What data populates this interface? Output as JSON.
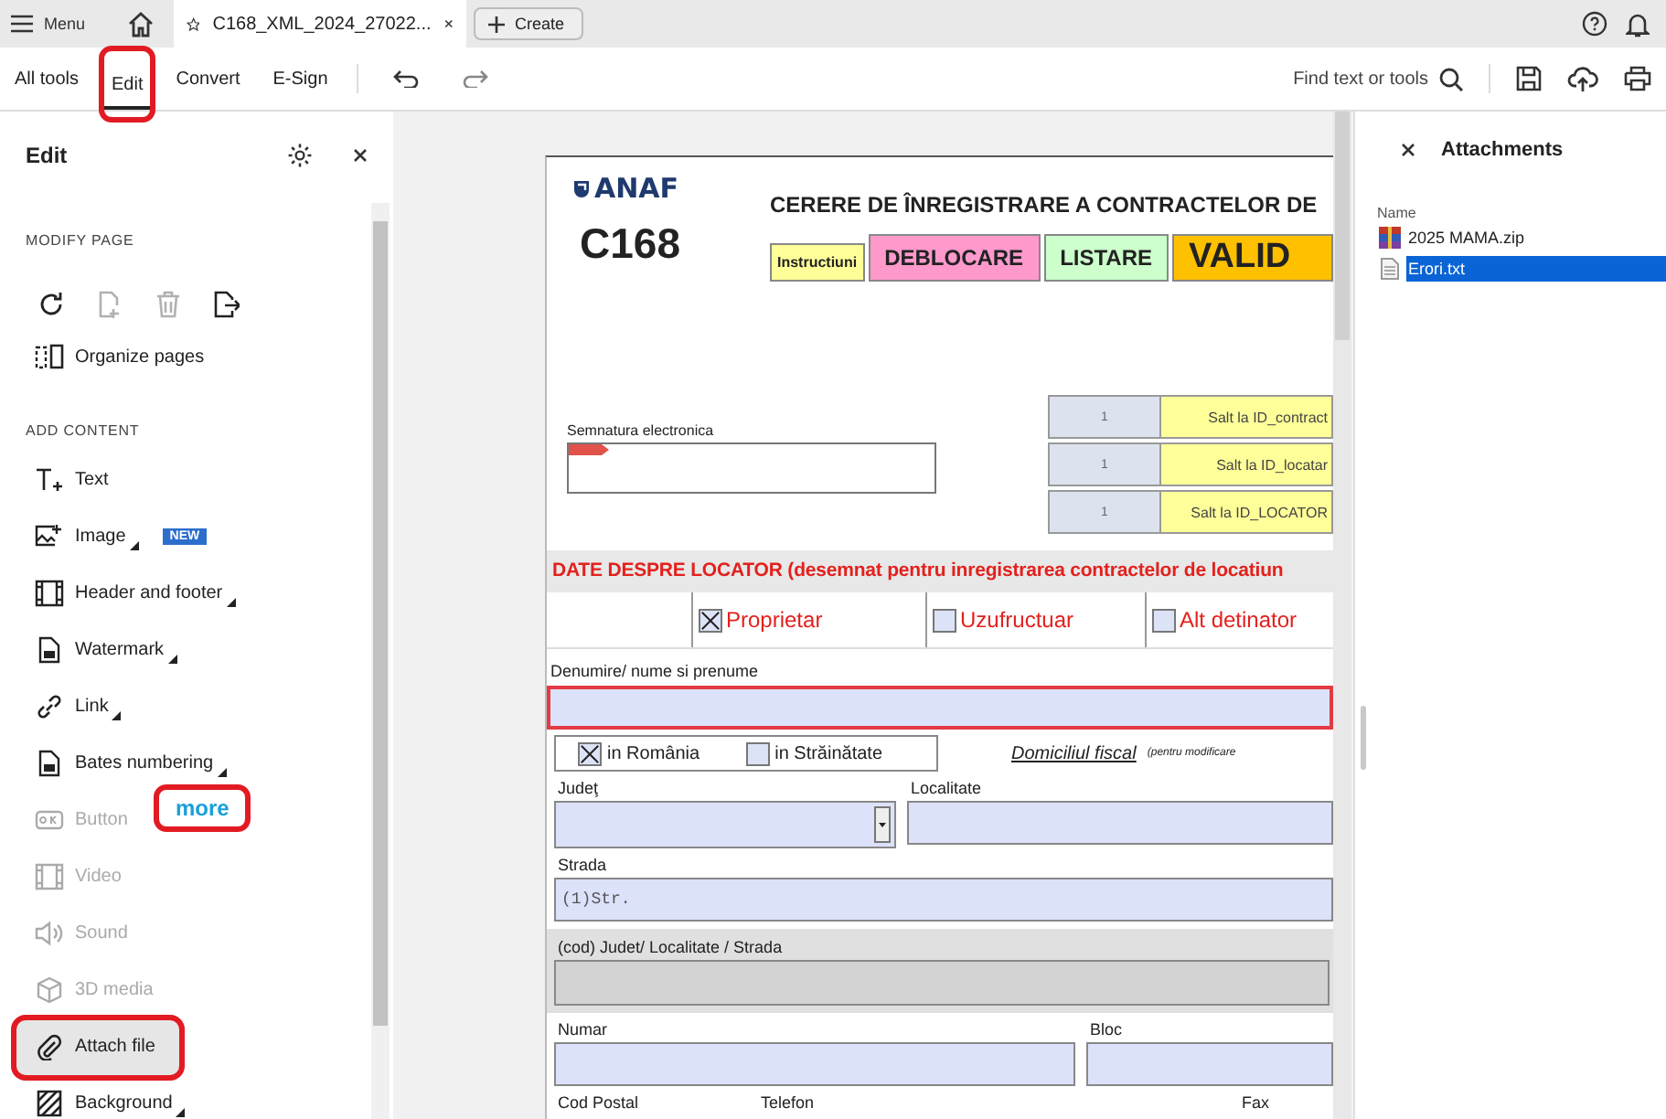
{
  "top_bar": {
    "menu": "Menu",
    "tab_title": "C168_XML_2024_27022...",
    "create": "Create"
  },
  "toolbar": {
    "tabs": [
      {
        "label": "All tools",
        "selected": false,
        "circled": false
      },
      {
        "label": "Edit",
        "selected": true,
        "circled": true
      },
      {
        "label": "Convert",
        "selected": false,
        "circled": false
      },
      {
        "label": "E-Sign",
        "selected": false,
        "circled": false
      }
    ],
    "search": "Find text or tools"
  },
  "edit_panel": {
    "title": "Edit",
    "modify_heading": "MODIFY PAGE",
    "page_tools": [
      {
        "kind": "rotate",
        "disabled": false
      },
      {
        "kind": "insert",
        "disabled": true
      },
      {
        "kind": "delete",
        "disabled": true
      },
      {
        "kind": "extract",
        "disabled": false
      }
    ],
    "organize": "Organize pages",
    "add_heading": "ADD CONTENT",
    "items": [
      {
        "kind": "text",
        "label": "Text",
        "disabled": false,
        "has_menu": false,
        "selected": false,
        "circled": false
      },
      {
        "kind": "image",
        "label": "Image",
        "badge": "NEW",
        "disabled": false,
        "has_menu": true,
        "selected": false,
        "circled": false
      },
      {
        "kind": "header",
        "label": "Header and footer",
        "disabled": false,
        "has_menu": true,
        "selected": false,
        "circled": false
      },
      {
        "kind": "watermark",
        "label": "Watermark",
        "disabled": false,
        "has_menu": true,
        "selected": false,
        "circled": false
      },
      {
        "kind": "link",
        "label": "Link",
        "disabled": false,
        "has_menu": true,
        "selected": false,
        "circled": false
      },
      {
        "kind": "bates",
        "label": "Bates numbering",
        "disabled": false,
        "has_menu": true,
        "selected": false,
        "circled": false
      },
      {
        "kind": "button",
        "label": "Button",
        "disabled": true,
        "has_menu": false,
        "selected": false,
        "circled": false
      },
      {
        "kind": "video",
        "label": "Video",
        "disabled": true,
        "has_menu": false,
        "selected": false,
        "circled": false
      },
      {
        "kind": "sound",
        "label": "Sound",
        "disabled": true,
        "has_menu": false,
        "selected": false,
        "circled": false
      },
      {
        "kind": "media3d",
        "label": "3D media",
        "disabled": true,
        "has_menu": false,
        "selected": false,
        "circled": false
      },
      {
        "kind": "attach",
        "label": "Attach file",
        "disabled": false,
        "has_menu": false,
        "selected": true,
        "circled": true
      },
      {
        "kind": "background",
        "label": "Background",
        "disabled": false,
        "has_menu": true,
        "selected": false,
        "circled": false
      }
    ],
    "note": {
      "text": "more",
      "circled": true
    }
  },
  "document": {
    "logo": "ANAF",
    "code": "C168",
    "title": "CERERE DE ÎNREGISTRARE A CONTRACTELOR DE",
    "buttons": [
      {
        "label": "Instructiuni",
        "color": "#ffff99"
      },
      {
        "label": "DEBLOCARE",
        "color": "#ff99cc"
      },
      {
        "label": "LISTARE",
        "color": "#ccffcc"
      },
      {
        "label": "VALID",
        "color": "#ffc000"
      }
    ],
    "signature_label": "Semnatura electronica",
    "jumps": [
      {
        "value": "1",
        "label": "Salt la ID_contract"
      },
      {
        "value": "1",
        "label": "Salt la ID_locatar"
      },
      {
        "value": "1",
        "label": "Salt la ID_LOCATOR"
      }
    ],
    "section_title": "DATE DESPRE LOCATOR (desemnat pentru inregistrarea contractelor de locatiun",
    "roles": [
      {
        "label": "Proprietar",
        "checked": true
      },
      {
        "label": "Uzufructuar",
        "checked": false
      },
      {
        "label": "Alt detinator",
        "checked": false
      }
    ],
    "name_field": {
      "label": "Denumire/ nume si prenume",
      "required": true
    },
    "residence": [
      {
        "label": "in România",
        "checked": true
      },
      {
        "label": "in Străinătate",
        "checked": false
      }
    ],
    "fiscal_label": "Domiciliul fiscal",
    "fiscal_note": "(pentru modificare",
    "field_rows": [
      [
        {
          "kind": "select",
          "label": "Judeţ"
        },
        {
          "kind": "text",
          "label": "Localitate"
        }
      ],
      [
        {
          "kind": "text",
          "label": "Strada",
          "value": "(1)Str."
        }
      ],
      [
        {
          "kind": "readonly",
          "label": "(cod) Judet/ Localitate / Strada"
        }
      ],
      [
        {
          "kind": "text",
          "label": "Numar"
        },
        {
          "kind": "text",
          "label": "Bloc"
        }
      ],
      [
        {
          "kind": "label",
          "label": "Cod Postal"
        },
        {
          "kind": "label",
          "label": "Telefon"
        },
        {
          "kind": "label",
          "label": "Fax"
        }
      ]
    ]
  },
  "attachments": {
    "title": "Attachments",
    "column": "Name",
    "files": [
      {
        "kind": "zip",
        "name": "2025 MAMA.zip",
        "selected": false
      },
      {
        "kind": "txt",
        "name": "Erori.txt",
        "selected": true
      }
    ]
  }
}
